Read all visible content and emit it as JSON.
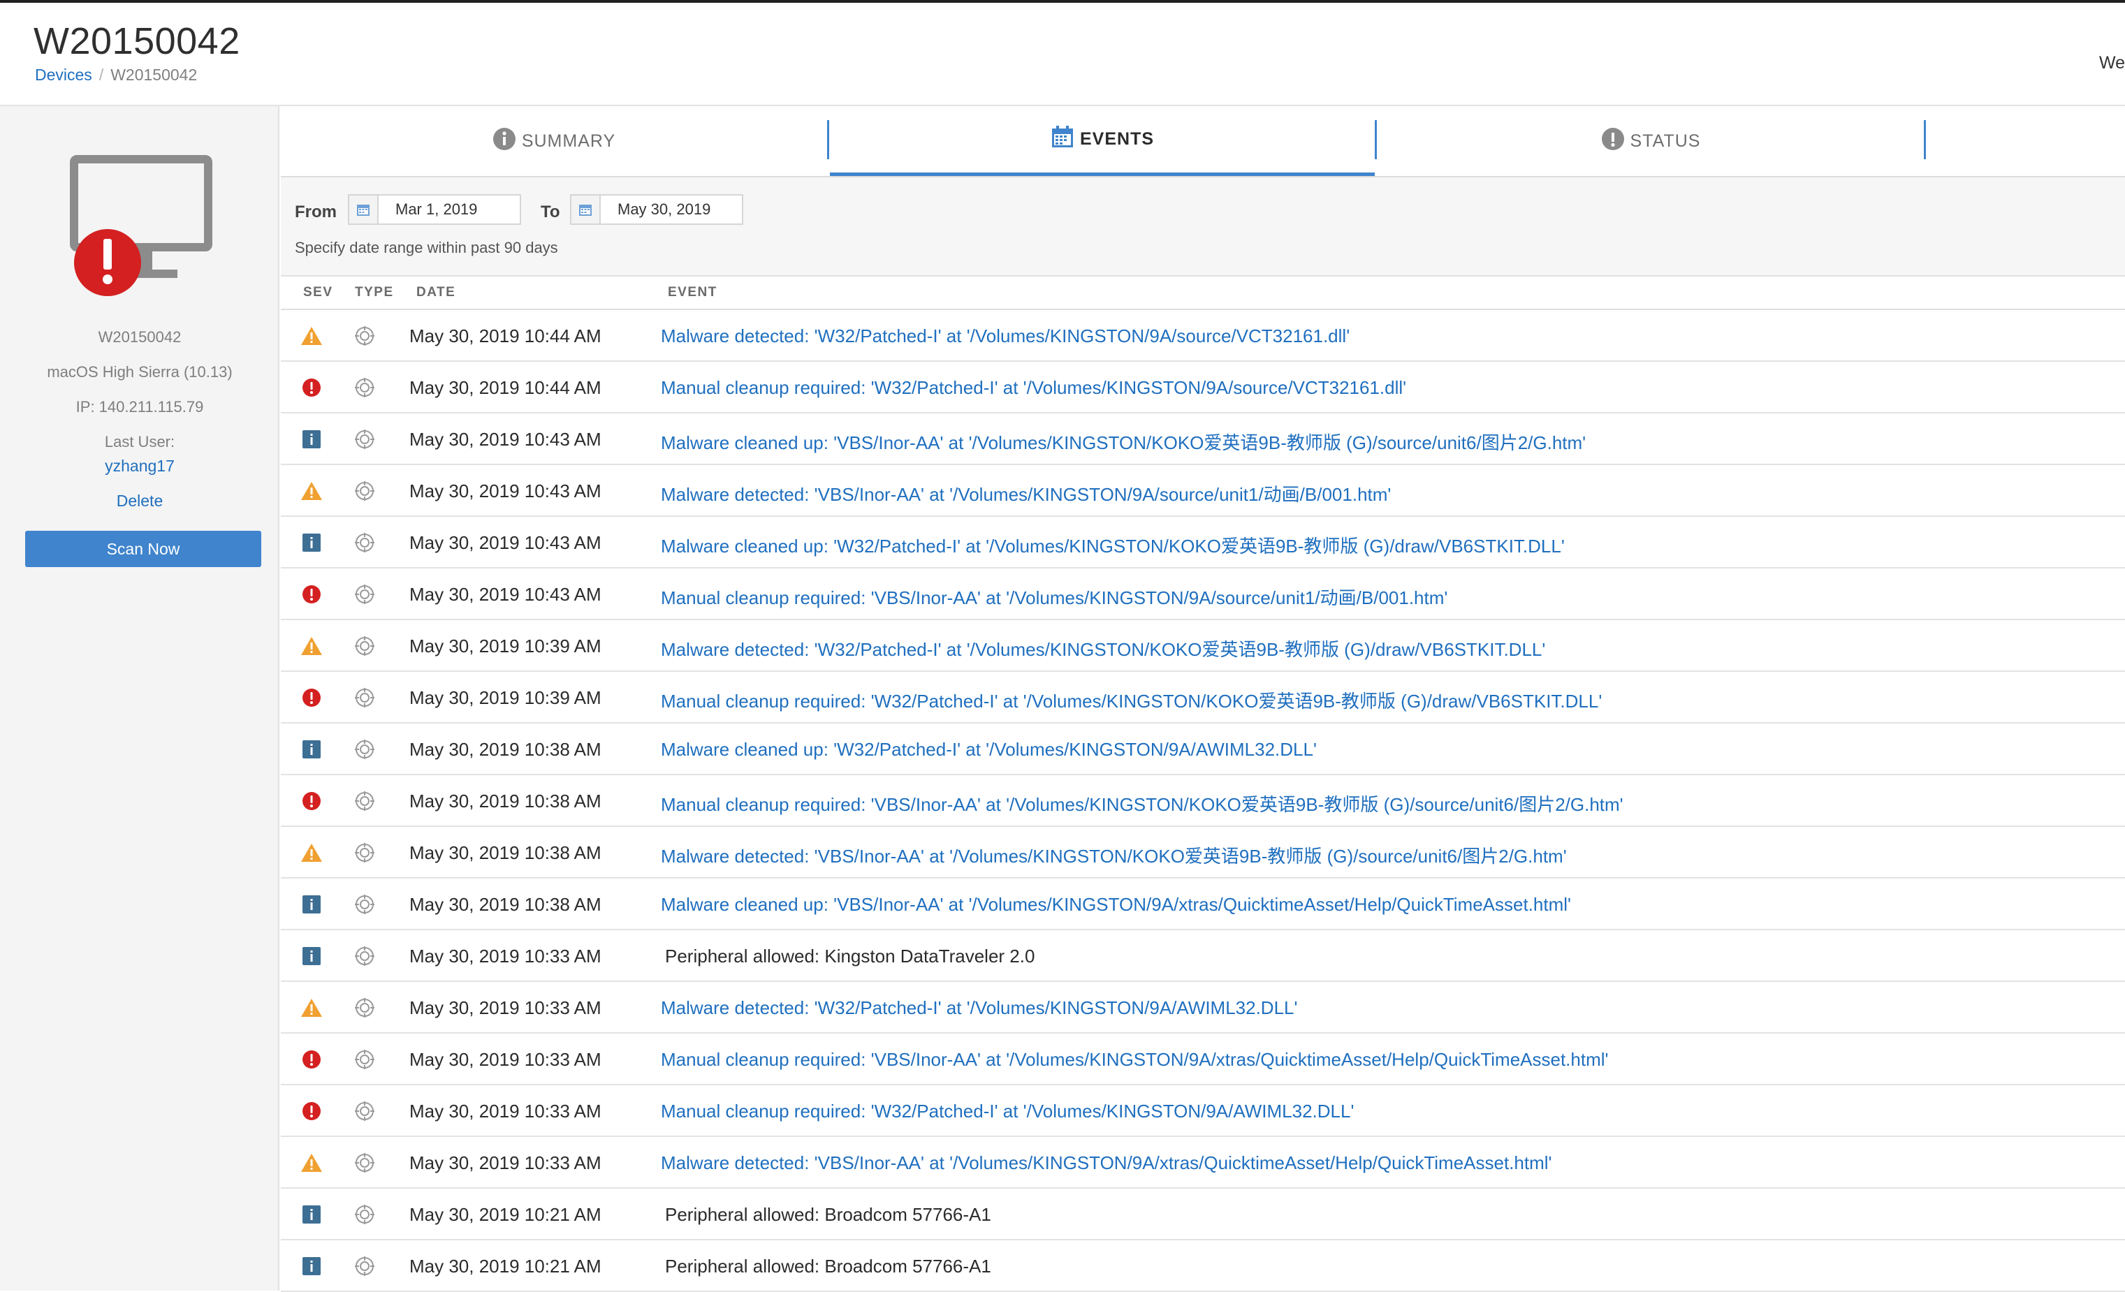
{
  "header": {
    "title": "W20150042",
    "breadcrumb": {
      "parent": "Devices",
      "separator": "/",
      "current": "W20150042"
    },
    "user_partial": "We"
  },
  "sidebar": {
    "device_name": "W20150042",
    "os": "macOS High Sierra (10.13)",
    "ip": "IP: 140.211.115.79",
    "last_user_label": "Last User:",
    "last_user": "yzhang17",
    "delete_label": "Delete",
    "scan_label": "Scan Now",
    "alert_icon": "alert-circle-icon"
  },
  "tabs": [
    {
      "label": "SUMMARY",
      "icon": "info-icon",
      "active": false
    },
    {
      "label": "EVENTS",
      "icon": "calendar-icon",
      "active": true
    },
    {
      "label": "STATUS",
      "icon": "alert-icon",
      "active": false
    }
  ],
  "filter": {
    "from_label": "From",
    "from_value": "Mar 1, 2019",
    "to_label": "To",
    "to_value": "May 30, 2019",
    "hint": "Specify date range within past 90 days"
  },
  "columns": {
    "sev": "SEV",
    "type": "TYPE",
    "date": "DATE",
    "event": "EVENT"
  },
  "colors": {
    "accent": "#3f84cc",
    "link": "#1f6fbf",
    "warning": "#f0a030",
    "error": "#d42020",
    "info": "#3d6e94"
  },
  "events": [
    {
      "sev": "warning",
      "date": "May 30, 2019 10:44 AM",
      "event": "Malware detected: 'W32/Patched-I' at '/Volumes/KINGSTON/9A/source/VCT32161.dll'",
      "link": true
    },
    {
      "sev": "error",
      "date": "May 30, 2019 10:44 AM",
      "event": "Manual cleanup required: 'W32/Patched-I' at '/Volumes/KINGSTON/9A/source/VCT32161.dll'",
      "link": true
    },
    {
      "sev": "info",
      "date": "May 30, 2019 10:43 AM",
      "event": "Malware cleaned up: 'VBS/Inor-AA' at '/Volumes/KINGSTON/KOKO爱英语9B-教师版 (G)/source/unit6/图片2/G.htm'",
      "link": true
    },
    {
      "sev": "warning",
      "date": "May 30, 2019 10:43 AM",
      "event": "Malware detected: 'VBS/Inor-AA' at '/Volumes/KINGSTON/9A/source/unit1/动画/B/001.htm'",
      "link": true
    },
    {
      "sev": "info",
      "date": "May 30, 2019 10:43 AM",
      "event": "Malware cleaned up: 'W32/Patched-I' at '/Volumes/KINGSTON/KOKO爱英语9B-教师版 (G)/draw/VB6STKIT.DLL'",
      "link": true
    },
    {
      "sev": "error",
      "date": "May 30, 2019 10:43 AM",
      "event": "Manual cleanup required: 'VBS/Inor-AA' at '/Volumes/KINGSTON/9A/source/unit1/动画/B/001.htm'",
      "link": true
    },
    {
      "sev": "warning",
      "date": "May 30, 2019 10:39 AM",
      "event": "Malware detected: 'W32/Patched-I' at '/Volumes/KINGSTON/KOKO爱英语9B-教师版 (G)/draw/VB6STKIT.DLL'",
      "link": true
    },
    {
      "sev": "error",
      "date": "May 30, 2019 10:39 AM",
      "event": "Manual cleanup required: 'W32/Patched-I' at '/Volumes/KINGSTON/KOKO爱英语9B-教师版 (G)/draw/VB6STKIT.DLL'",
      "link": true
    },
    {
      "sev": "info",
      "date": "May 30, 2019 10:38 AM",
      "event": "Malware cleaned up: 'W32/Patched-I' at '/Volumes/KINGSTON/9A/AWIML32.DLL'",
      "link": true
    },
    {
      "sev": "error",
      "date": "May 30, 2019 10:38 AM",
      "event": "Manual cleanup required: 'VBS/Inor-AA' at '/Volumes/KINGSTON/KOKO爱英语9B-教师版 (G)/source/unit6/图片2/G.htm'",
      "link": true
    },
    {
      "sev": "warning",
      "date": "May 30, 2019 10:38 AM",
      "event": "Malware detected: 'VBS/Inor-AA' at '/Volumes/KINGSTON/KOKO爱英语9B-教师版 (G)/source/unit6/图片2/G.htm'",
      "link": true
    },
    {
      "sev": "info",
      "date": "May 30, 2019 10:38 AM",
      "event": "Malware cleaned up: 'VBS/Inor-AA' at '/Volumes/KINGSTON/9A/xtras/QuicktimeAsset/Help/QuickTimeAsset.html'",
      "link": true
    },
    {
      "sev": "info",
      "date": "May 30, 2019 10:33 AM",
      "event": "Peripheral allowed: Kingston DataTraveler 2.0",
      "link": false
    },
    {
      "sev": "warning",
      "date": "May 30, 2019 10:33 AM",
      "event": "Malware detected: 'W32/Patched-I' at '/Volumes/KINGSTON/9A/AWIML32.DLL'",
      "link": true
    },
    {
      "sev": "error",
      "date": "May 30, 2019 10:33 AM",
      "event": "Manual cleanup required: 'VBS/Inor-AA' at '/Volumes/KINGSTON/9A/xtras/QuicktimeAsset/Help/QuickTimeAsset.html'",
      "link": true
    },
    {
      "sev": "error",
      "date": "May 30, 2019 10:33 AM",
      "event": "Manual cleanup required: 'W32/Patched-I' at '/Volumes/KINGSTON/9A/AWIML32.DLL'",
      "link": true
    },
    {
      "sev": "warning",
      "date": "May 30, 2019 10:33 AM",
      "event": "Malware detected: 'VBS/Inor-AA' at '/Volumes/KINGSTON/9A/xtras/QuicktimeAsset/Help/QuickTimeAsset.html'",
      "link": true
    },
    {
      "sev": "info",
      "date": "May 30, 2019 10:21 AM",
      "event": "Peripheral allowed: Broadcom 57766-A1",
      "link": false
    },
    {
      "sev": "info",
      "date": "May 30, 2019 10:21 AM",
      "event": "Peripheral allowed: Broadcom 57766-A1",
      "link": false
    }
  ]
}
